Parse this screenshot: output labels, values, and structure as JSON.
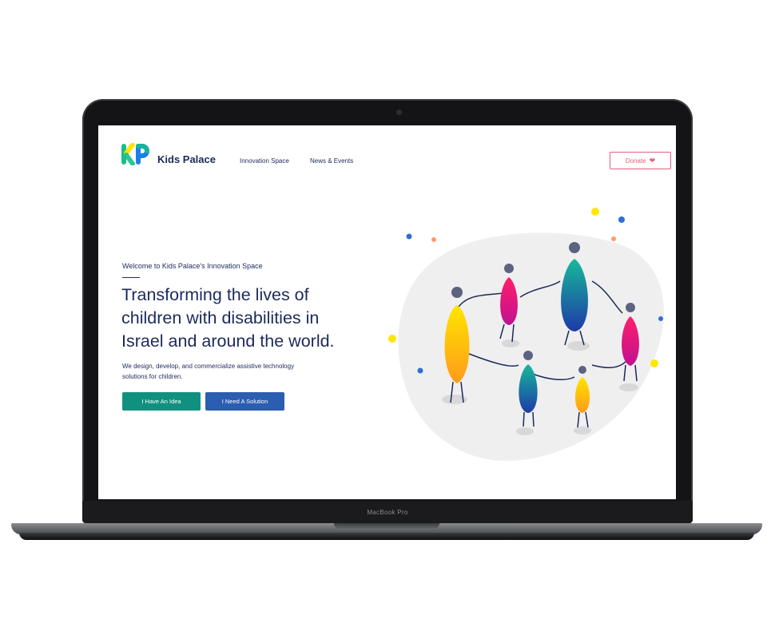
{
  "device": {
    "model_label": "MacBook Pro"
  },
  "header": {
    "logo_mark": "KP",
    "brand": "Kids Palace",
    "nav": [
      "Innovation Space",
      "News & Events"
    ],
    "donate_label": "Donate"
  },
  "hero": {
    "eyebrow": "Welcome to Kids Palace's Innovation Space",
    "headline_lines": [
      "Transforming the lives of",
      "children with disabilities in",
      "Israel and around the world."
    ],
    "description_lines": [
      "We design, develop, and commercialize assistive technology",
      "solutions for children."
    ],
    "primary_button": "I Have An Idea",
    "secondary_button": "I Need A Solution"
  },
  "colors": {
    "navy": "#1d2a5c",
    "donate_pink": "#e95d7f",
    "primary_green": "#10917f",
    "secondary_blue": "#2b5db0",
    "logo_green": "#17c08a",
    "logo_yellow": "#ffe600",
    "logo_blue": "#1e7ee8"
  },
  "icons": {
    "donate": "heart-icon",
    "illustration": "children-holding-hands-illustration"
  }
}
